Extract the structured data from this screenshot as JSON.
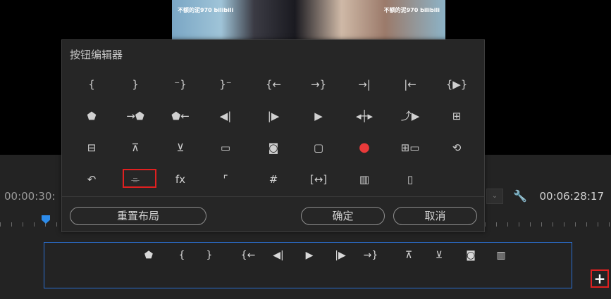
{
  "preview": {
    "watermark_left": "不额的泥970 bilibili",
    "watermark_right": "不额的泥970 bilibili"
  },
  "timeline": {
    "timecode_left": "00:00:30:",
    "timecode_right": "00:06:28:17",
    "wrench_glyph": "🔧",
    "dropdown_glyph": "⌄",
    "add_glyph": "+"
  },
  "dialog": {
    "title": "按钮编辑器",
    "reset_label": "重置布局",
    "ok_label": "确定",
    "cancel_label": "取消",
    "icons": [
      {
        "name": "mark-in-icon",
        "glyph": "{"
      },
      {
        "name": "mark-out-icon",
        "glyph": "}"
      },
      {
        "name": "mark-clip-icon",
        "glyph": "⁻}"
      },
      {
        "name": "go-to-in-variant-icon",
        "glyph": "}⁻"
      },
      {
        "name": "go-to-in-icon",
        "glyph": "{←"
      },
      {
        "name": "go-to-out-icon",
        "glyph": "→}"
      },
      {
        "name": "go-to-next-edit-icon",
        "glyph": "→|"
      },
      {
        "name": "go-to-prev-edit-icon",
        "glyph": "|←"
      },
      {
        "name": "play-in-to-out-icon",
        "glyph": "{▶}"
      },
      {
        "name": "add-marker-icon",
        "glyph": "⬟"
      },
      {
        "name": "go-to-next-marker-icon",
        "glyph": "→⬟"
      },
      {
        "name": "go-to-prev-marker-icon",
        "glyph": "⬟←"
      },
      {
        "name": "step-back-icon",
        "glyph": "◀|"
      },
      {
        "name": "step-forward-icon",
        "glyph": "|▶"
      },
      {
        "name": "play-stop-icon",
        "glyph": "▶"
      },
      {
        "name": "shuttle-icon",
        "glyph": "◂┼▸"
      },
      {
        "name": "play-around-icon",
        "glyph": "⤴▶"
      },
      {
        "name": "insert-icon",
        "glyph": "⊞"
      },
      {
        "name": "overwrite-icon",
        "glyph": "⊟"
      },
      {
        "name": "lift-icon",
        "glyph": "⊼"
      },
      {
        "name": "extract-icon",
        "glyph": "⊻"
      },
      {
        "name": "safe-margins-icon",
        "glyph": "▭"
      },
      {
        "name": "export-frame-camera-icon",
        "glyph": "◙"
      },
      {
        "name": "comment-icon",
        "glyph": "▢"
      },
      {
        "name": "record-icon",
        "glyph": "●",
        "color": "#e93a3a"
      },
      {
        "name": "multi-camera-icon",
        "glyph": "⊞▭"
      },
      {
        "name": "toggle-proxies-icon",
        "glyph": "⟲"
      },
      {
        "name": "loop-icon",
        "glyph": "↶"
      },
      {
        "name": "vr-video-icon",
        "glyph": "⌯"
      },
      {
        "name": "fx-icon",
        "glyph": "fx"
      },
      {
        "name": "show-rulers-icon",
        "glyph": "⌜"
      },
      {
        "name": "show-guides-icon",
        "glyph": "#"
      },
      {
        "name": "snap-icon",
        "glyph": "[↔]"
      },
      {
        "name": "filmstrip-icon",
        "glyph": "▥"
      },
      {
        "name": "spacer-icon",
        "glyph": "▯"
      }
    ]
  },
  "button_bar": {
    "buttons": [
      {
        "name": "add-marker-icon",
        "glyph": "⬟"
      },
      {
        "name": "mark-in-icon",
        "glyph": "{"
      },
      {
        "name": "mark-out-icon",
        "glyph": "}"
      },
      {
        "name": "go-to-in-icon",
        "glyph": "{←"
      },
      {
        "name": "step-back-icon",
        "glyph": "◀|"
      },
      {
        "name": "play-stop-icon",
        "glyph": "▶"
      },
      {
        "name": "step-forward-icon",
        "glyph": "|▶"
      },
      {
        "name": "go-to-out-icon",
        "glyph": "→}"
      },
      {
        "name": "lift-icon",
        "glyph": "⊼"
      },
      {
        "name": "extract-icon",
        "glyph": "⊻"
      },
      {
        "name": "export-frame-camera-icon",
        "glyph": "◙"
      },
      {
        "name": "filmstrip-icon",
        "glyph": "▥"
      }
    ]
  },
  "colors": {
    "accent_blue": "#2d8ceb",
    "highlight_red": "#e02020",
    "record_red": "#e93a3a"
  }
}
